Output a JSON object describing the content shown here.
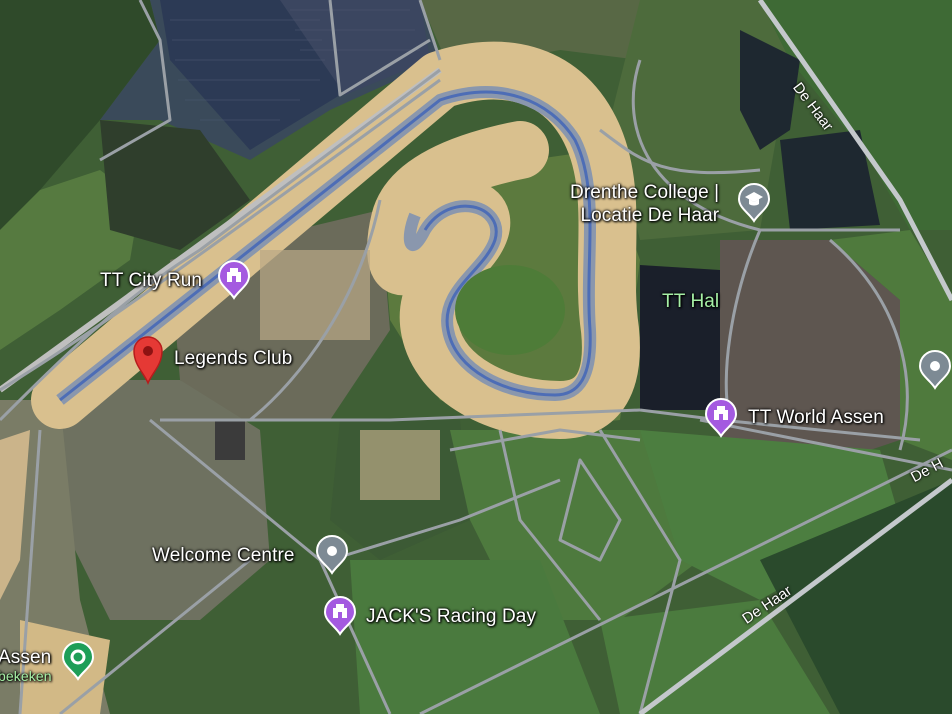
{
  "map": {
    "places": [
      {
        "id": "drenthe",
        "label_line1": "Drenthe College |",
        "label_line2": "Locatie De Haar",
        "icon": "school-icon",
        "color": "#7d8a94"
      },
      {
        "id": "tthal",
        "label": "TT Hal",
        "color": "#a6f0a6"
      },
      {
        "id": "citrun",
        "label": "TT City Run",
        "icon": "attraction-icon",
        "color": "#a45ae0"
      },
      {
        "id": "legends",
        "label": "Legends Club",
        "icon": "red-pin-icon",
        "color": "#e53935"
      },
      {
        "id": "ttworld",
        "label": "TT World Assen",
        "icon": "attraction-icon",
        "color": "#a45ae0"
      },
      {
        "id": "welcome",
        "label": "Welcome Centre",
        "icon": "generic-poi-icon",
        "color": "#7d8a94"
      },
      {
        "id": "jacks",
        "label": "JACK'S Racing Day",
        "icon": "attraction-icon",
        "color": "#a45ae0"
      },
      {
        "id": "assen",
        "label_line1": "Assen",
        "label_line2": "bekeken",
        "icon": "park-icon",
        "color": "#1e9e58"
      }
    ],
    "roads": [
      {
        "id": "dehaar_top",
        "label": "De Haar"
      },
      {
        "id": "dehaar_right",
        "label": "De H"
      },
      {
        "id": "dehaar_bottom",
        "label": "De Haar"
      }
    ]
  }
}
